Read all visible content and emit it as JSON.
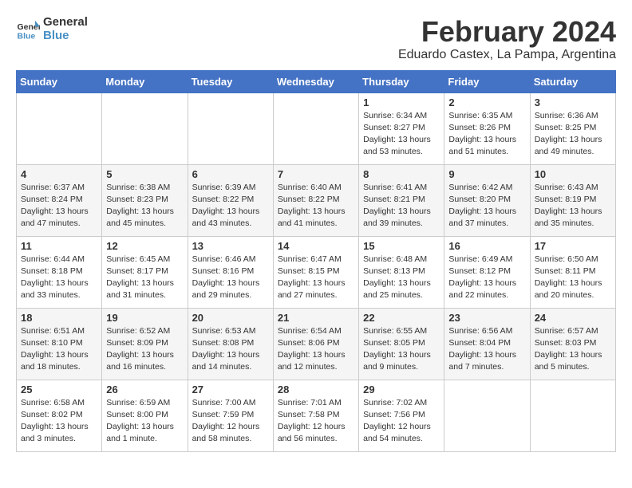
{
  "logo": {
    "text_general": "General",
    "text_blue": "Blue"
  },
  "header": {
    "title": "February 2024",
    "subtitle": "Eduardo Castex, La Pampa, Argentina"
  },
  "weekdays": [
    "Sunday",
    "Monday",
    "Tuesday",
    "Wednesday",
    "Thursday",
    "Friday",
    "Saturday"
  ],
  "weeks": [
    [
      {
        "day": "",
        "info": ""
      },
      {
        "day": "",
        "info": ""
      },
      {
        "day": "",
        "info": ""
      },
      {
        "day": "",
        "info": ""
      },
      {
        "day": "1",
        "info": "Sunrise: 6:34 AM\nSunset: 8:27 PM\nDaylight: 13 hours\nand 53 minutes."
      },
      {
        "day": "2",
        "info": "Sunrise: 6:35 AM\nSunset: 8:26 PM\nDaylight: 13 hours\nand 51 minutes."
      },
      {
        "day": "3",
        "info": "Sunrise: 6:36 AM\nSunset: 8:25 PM\nDaylight: 13 hours\nand 49 minutes."
      }
    ],
    [
      {
        "day": "4",
        "info": "Sunrise: 6:37 AM\nSunset: 8:24 PM\nDaylight: 13 hours\nand 47 minutes."
      },
      {
        "day": "5",
        "info": "Sunrise: 6:38 AM\nSunset: 8:23 PM\nDaylight: 13 hours\nand 45 minutes."
      },
      {
        "day": "6",
        "info": "Sunrise: 6:39 AM\nSunset: 8:22 PM\nDaylight: 13 hours\nand 43 minutes."
      },
      {
        "day": "7",
        "info": "Sunrise: 6:40 AM\nSunset: 8:22 PM\nDaylight: 13 hours\nand 41 minutes."
      },
      {
        "day": "8",
        "info": "Sunrise: 6:41 AM\nSunset: 8:21 PM\nDaylight: 13 hours\nand 39 minutes."
      },
      {
        "day": "9",
        "info": "Sunrise: 6:42 AM\nSunset: 8:20 PM\nDaylight: 13 hours\nand 37 minutes."
      },
      {
        "day": "10",
        "info": "Sunrise: 6:43 AM\nSunset: 8:19 PM\nDaylight: 13 hours\nand 35 minutes."
      }
    ],
    [
      {
        "day": "11",
        "info": "Sunrise: 6:44 AM\nSunset: 8:18 PM\nDaylight: 13 hours\nand 33 minutes."
      },
      {
        "day": "12",
        "info": "Sunrise: 6:45 AM\nSunset: 8:17 PM\nDaylight: 13 hours\nand 31 minutes."
      },
      {
        "day": "13",
        "info": "Sunrise: 6:46 AM\nSunset: 8:16 PM\nDaylight: 13 hours\nand 29 minutes."
      },
      {
        "day": "14",
        "info": "Sunrise: 6:47 AM\nSunset: 8:15 PM\nDaylight: 13 hours\nand 27 minutes."
      },
      {
        "day": "15",
        "info": "Sunrise: 6:48 AM\nSunset: 8:13 PM\nDaylight: 13 hours\nand 25 minutes."
      },
      {
        "day": "16",
        "info": "Sunrise: 6:49 AM\nSunset: 8:12 PM\nDaylight: 13 hours\nand 22 minutes."
      },
      {
        "day": "17",
        "info": "Sunrise: 6:50 AM\nSunset: 8:11 PM\nDaylight: 13 hours\nand 20 minutes."
      }
    ],
    [
      {
        "day": "18",
        "info": "Sunrise: 6:51 AM\nSunset: 8:10 PM\nDaylight: 13 hours\nand 18 minutes."
      },
      {
        "day": "19",
        "info": "Sunrise: 6:52 AM\nSunset: 8:09 PM\nDaylight: 13 hours\nand 16 minutes."
      },
      {
        "day": "20",
        "info": "Sunrise: 6:53 AM\nSunset: 8:08 PM\nDaylight: 13 hours\nand 14 minutes."
      },
      {
        "day": "21",
        "info": "Sunrise: 6:54 AM\nSunset: 8:06 PM\nDaylight: 13 hours\nand 12 minutes."
      },
      {
        "day": "22",
        "info": "Sunrise: 6:55 AM\nSunset: 8:05 PM\nDaylight: 13 hours\nand 9 minutes."
      },
      {
        "day": "23",
        "info": "Sunrise: 6:56 AM\nSunset: 8:04 PM\nDaylight: 13 hours\nand 7 minutes."
      },
      {
        "day": "24",
        "info": "Sunrise: 6:57 AM\nSunset: 8:03 PM\nDaylight: 13 hours\nand 5 minutes."
      }
    ],
    [
      {
        "day": "25",
        "info": "Sunrise: 6:58 AM\nSunset: 8:02 PM\nDaylight: 13 hours\nand 3 minutes."
      },
      {
        "day": "26",
        "info": "Sunrise: 6:59 AM\nSunset: 8:00 PM\nDaylight: 13 hours\nand 1 minute."
      },
      {
        "day": "27",
        "info": "Sunrise: 7:00 AM\nSunset: 7:59 PM\nDaylight: 12 hours\nand 58 minutes."
      },
      {
        "day": "28",
        "info": "Sunrise: 7:01 AM\nSunset: 7:58 PM\nDaylight: 12 hours\nand 56 minutes."
      },
      {
        "day": "29",
        "info": "Sunrise: 7:02 AM\nSunset: 7:56 PM\nDaylight: 12 hours\nand 54 minutes."
      },
      {
        "day": "",
        "info": ""
      },
      {
        "day": "",
        "info": ""
      }
    ]
  ]
}
